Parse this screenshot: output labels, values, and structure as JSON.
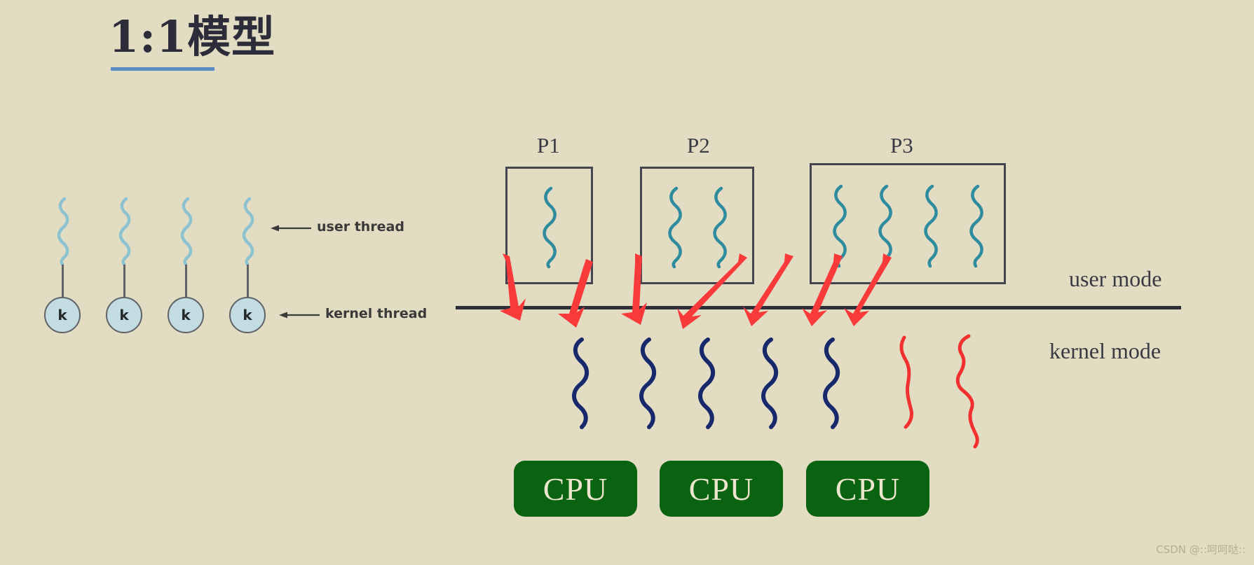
{
  "page": {
    "background_color": "#E2DCC3",
    "title": "1:1模型",
    "title_underline_color": "#5B8CC8",
    "watermark": "CSDN @::呵呵哒::"
  },
  "legend": {
    "user_thread_label": "user thread",
    "kernel_thread_label": "kernel thread",
    "kernel_node_letter": "k"
  },
  "modes": {
    "user_mode_label": "user mode",
    "kernel_mode_label": "kernel mode",
    "divider_color": "#2E2E38"
  },
  "left_diagram": {
    "pair_count": 4,
    "user_thread_color": "#8DC3D1",
    "kernel_circle_fill": "#C3DCE2",
    "kernel_circle_stroke": "#5E6366",
    "pairs": [
      {
        "letter": "k"
      },
      {
        "letter": "k"
      },
      {
        "letter": "k"
      },
      {
        "letter": "k"
      }
    ]
  },
  "processes": [
    {
      "label": "P1",
      "thread_count": 1
    },
    {
      "label": "P2",
      "thread_count": 2
    },
    {
      "label": "P3",
      "thread_count": 4
    }
  ],
  "kernel_threads": {
    "count": 5,
    "color": "#17286B",
    "annotation_squiggle_count": 2,
    "annotation_color": "#F23030"
  },
  "annotations": {
    "arrow_color": "#F93A3A",
    "arrow_count": 7
  },
  "cpus": [
    {
      "label": "CPU"
    },
    {
      "label": "CPU"
    },
    {
      "label": "CPU"
    }
  ],
  "colors": {
    "user_thread": "#8DC3D1",
    "process_thread": "#2F8C9E",
    "kernel_thread": "#17286B",
    "annotation_red": "#F93A3A",
    "cpu_green": "#0A6310",
    "box_stroke": "#44444E",
    "text": "#3A3A42"
  }
}
